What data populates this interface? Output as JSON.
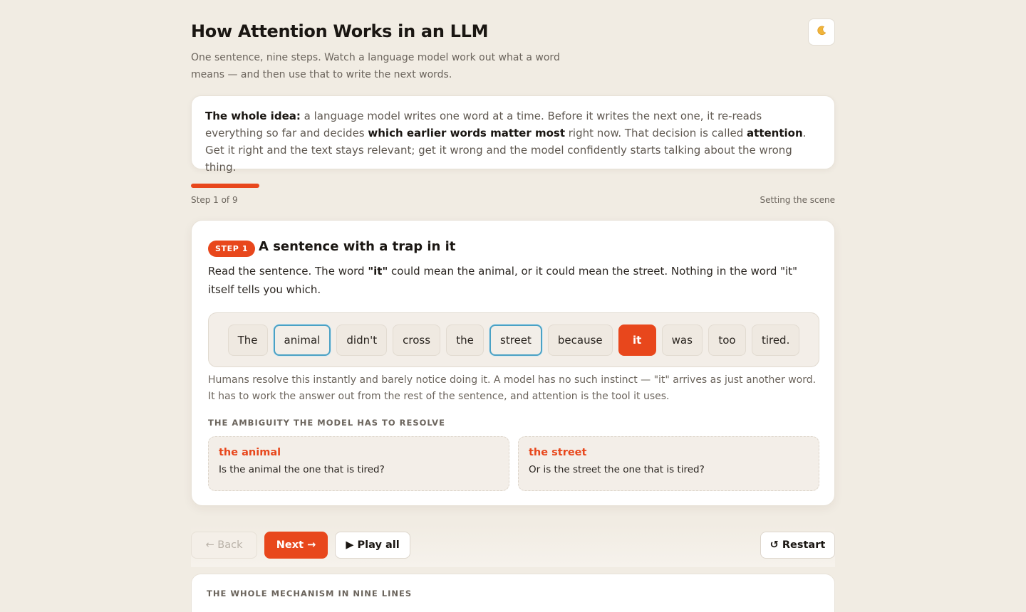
{
  "header": {
    "title": "How Attention Works in an LLM",
    "subtitle": "One sentence, nine steps. Watch a language model work out what a word means — and then use that to write the next words.",
    "theme_toggle_icon": "moon-icon"
  },
  "intro": {
    "lead": "The whole idea:",
    "text1": " a language model writes one word at a time. Before it writes the next one, it re-reads everything so far and decides ",
    "bold1": "which earlier words matter most",
    "text2": " right now. That decision is called ",
    "bold2": "attention",
    "text3": ". Get it right and the text stays relevant; get it wrong and the model confidently starts talking about the wrong thing."
  },
  "progress": {
    "current_step": 1,
    "total_steps": 9,
    "fraction": 0.106,
    "label": "Step 1 of 9",
    "phase": "Setting the scene",
    "color": "#e8471c"
  },
  "step": {
    "badge": "STEP 1",
    "title": "A sentence with a trap in it",
    "desc_pre": "Read the sentence. The word ",
    "desc_bold": "\"it\"",
    "desc_post": " could mean the animal, or it could mean the street. Nothing in the word \"it\" itself tells you which.",
    "tokens": [
      {
        "text": "The",
        "state": "normal"
      },
      {
        "text": "animal",
        "state": "candidate"
      },
      {
        "text": "didn't",
        "state": "normal"
      },
      {
        "text": "cross",
        "state": "normal"
      },
      {
        "text": "the",
        "state": "normal"
      },
      {
        "text": "street",
        "state": "candidate"
      },
      {
        "text": "because",
        "state": "normal"
      },
      {
        "text": "it",
        "state": "focus"
      },
      {
        "text": "was",
        "state": "normal"
      },
      {
        "text": "too",
        "state": "normal"
      },
      {
        "text": "tired.",
        "state": "normal"
      }
    ],
    "explain": "Humans resolve this instantly and barely notice doing it. A model has no such instinct — \"it\" arrives as just another word. It has to work the answer out from the rest of the sentence, and attention is the tool it uses.",
    "ambiguity_heading": "THE AMBIGUITY THE MODEL HAS TO RESOLVE",
    "options": [
      {
        "title": "the animal",
        "question": "Is the animal the one that is tired?"
      },
      {
        "title": "the street",
        "question": "Or is the street the one that is tired?"
      }
    ]
  },
  "controls": {
    "back": "← Back",
    "next": "Next →",
    "play_all": "▶ Play all",
    "restart": "↺ Restart"
  },
  "summary": {
    "heading": "THE WHOLE MECHANISM IN NINE LINES"
  },
  "colors": {
    "accent": "#e8471c",
    "candidate_outline": "#4aa1c4",
    "background": "#f1ece3"
  }
}
